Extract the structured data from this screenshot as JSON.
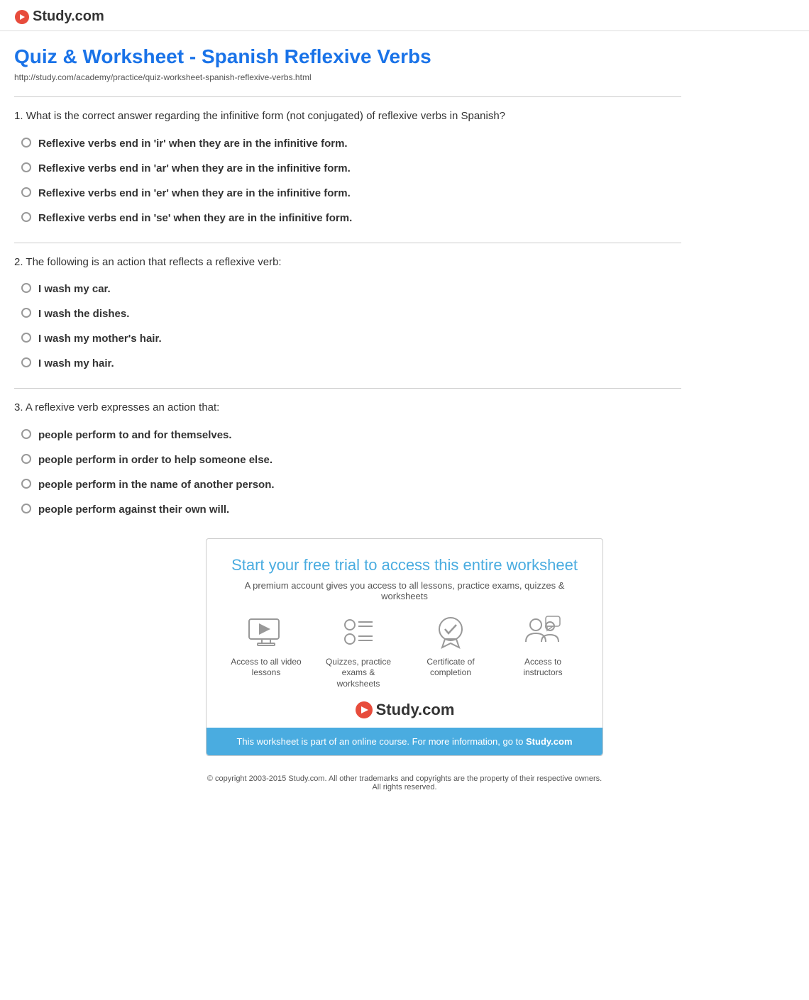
{
  "header": {
    "logo_text": "Study.com",
    "logo_aria": "Study.com logo"
  },
  "page": {
    "title": "Quiz & Worksheet - Spanish Reflexive Verbs",
    "url": "http://study.com/academy/practice/quiz-worksheet-spanish-reflexive-verbs.html"
  },
  "questions": [
    {
      "number": "1",
      "text": "What is the correct answer regarding the infinitive form (not conjugated) of reflexive verbs in Spanish?",
      "answers": [
        "Reflexive verbs end in 'ir' when they are in the infinitive form.",
        "Reflexive verbs end in 'ar' when they are in the infinitive form.",
        "Reflexive verbs end in 'er' when they are in the infinitive form.",
        "Reflexive verbs end in 'se' when they are in the infinitive form."
      ]
    },
    {
      "number": "2",
      "text": "The following is an action that reflects a reflexive verb:",
      "answers": [
        "I wash my car.",
        "I wash the dishes.",
        "I wash my mother's hair.",
        "I wash my hair."
      ]
    },
    {
      "number": "3",
      "text": "A reflexive verb expresses an action that:",
      "answers": [
        "people perform to and for themselves.",
        "people perform in order to help someone else.",
        "people perform in the name of another person.",
        "people perform against their own will."
      ]
    }
  ],
  "cta": {
    "title": "Start your free trial to access this entire worksheet",
    "subtitle": "A premium account gives you access to all lessons, practice exams, quizzes & worksheets",
    "icons": [
      {
        "label": "Access to all video lessons",
        "icon": "video"
      },
      {
        "label": "Quizzes, practice exams & worksheets",
        "icon": "list"
      },
      {
        "label": "Certificate of completion",
        "icon": "certificate"
      },
      {
        "label": "Access to instructors",
        "icon": "instructors"
      }
    ],
    "logo_text": "Study.com",
    "banner_text": "This worksheet is part of an online course. For more information, go to ",
    "banner_link": "Study.com"
  },
  "footer": {
    "copyright": "© copyright 2003-2015 Study.com. All other trademarks and copyrights are the property of their respective owners.",
    "rights": "All rights reserved."
  }
}
